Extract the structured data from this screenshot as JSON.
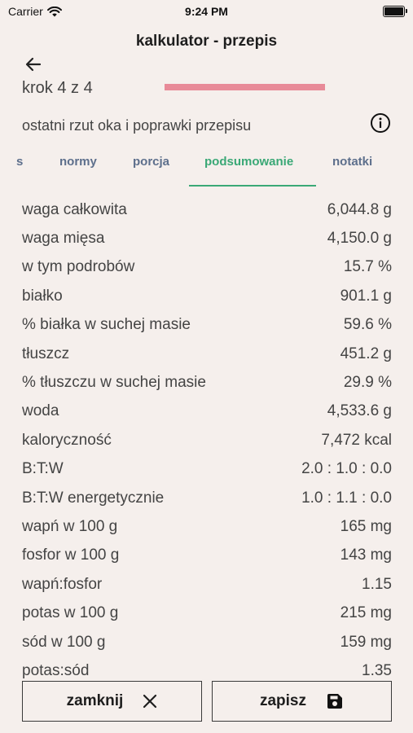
{
  "status": {
    "carrier": "Carrier",
    "time": "9:24 PM"
  },
  "header": {
    "title": "kalkulator - przepis"
  },
  "step": {
    "label": "krok 4 z 4",
    "progress": 1.0
  },
  "subtitle": "ostatni rzut oka i poprawki przepisu",
  "tabs": [
    {
      "label": "s",
      "active": false
    },
    {
      "label": "normy",
      "active": false
    },
    {
      "label": "porcja",
      "active": false
    },
    {
      "label": "podsumowanie",
      "active": true
    },
    {
      "label": "notatki",
      "active": false
    }
  ],
  "summary": [
    {
      "label": "waga całkowita",
      "value": "6,044.8 g"
    },
    {
      "label": "waga mięsa",
      "value": "4,150.0 g"
    },
    {
      "label": "w tym podrobów",
      "value": "15.7 %"
    },
    {
      "label": "białko",
      "value": "901.1 g"
    },
    {
      "label": "% białka w suchej masie",
      "value": "59.6 %"
    },
    {
      "label": "tłuszcz",
      "value": "451.2 g"
    },
    {
      "label": "% tłuszczu w suchej masie",
      "value": "29.9 %"
    },
    {
      "label": "woda",
      "value": "4,533.6 g"
    },
    {
      "label": "kaloryczność",
      "value": "7,472 kcal"
    },
    {
      "label": "B:T:W",
      "value": "2.0 : 1.0 : 0.0"
    },
    {
      "label": "B:T:W energetycznie",
      "value": "1.0 : 1.1 : 0.0"
    },
    {
      "label": "wapń w 100 g",
      "value": "165 mg"
    },
    {
      "label": "fosfor w 100 g",
      "value": "143 mg"
    },
    {
      "label": "wapń:fosfor",
      "value": "1.15"
    },
    {
      "label": "potas w 100 g",
      "value": "215 mg"
    },
    {
      "label": "sód w 100 g",
      "value": "159 mg"
    },
    {
      "label": "potas:sód",
      "value": "1.35"
    }
  ],
  "footer": {
    "close_label": "zamknij",
    "save_label": "zapisz"
  },
  "colors": {
    "accent_green": "#3aa876",
    "progress_pink": "#e88a98",
    "background": "#f5efec"
  }
}
